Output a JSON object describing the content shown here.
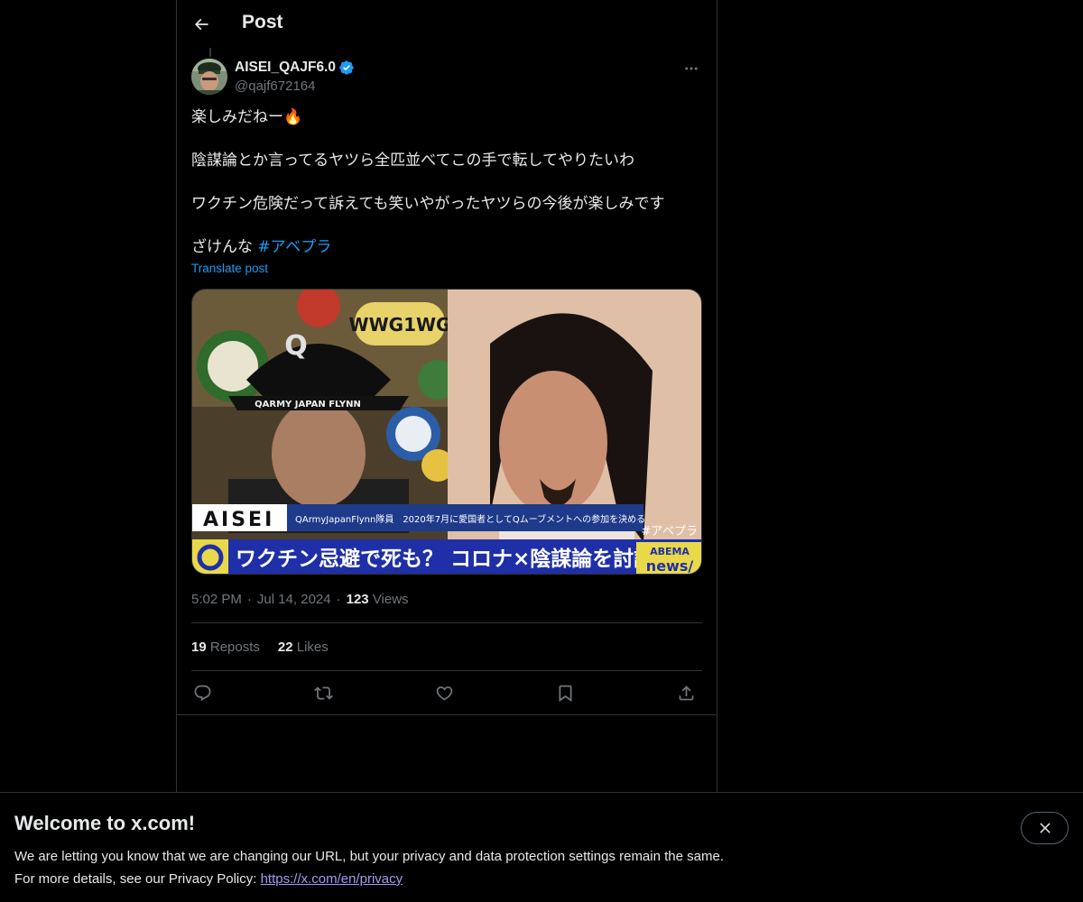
{
  "header": {
    "title": "Post"
  },
  "author": {
    "display_name": "AISEI_QAJF6.0",
    "handle": "@qajf672164",
    "verified": true
  },
  "post": {
    "lines": [
      "楽しみだねー🔥",
      "陰謀論とか言ってるヤツら全匹並べてこの手で転してやりたいわ",
      "ワクチン危険だって訴えても笑いやがったヤツらの今後が楽しみです"
    ],
    "last_line_text": "ざけんな ",
    "hashtag": "#アベプラ",
    "translate_label": "Translate post"
  },
  "media": {
    "name_plate": "AISEI",
    "caption_small": "QArmyJapanFlynn隊員　2020年7月に愛国者としてQムーブメントへの参加を決める",
    "caption_main": "ワクチン忌避で死も？ コロナ×陰謀論を討論",
    "hashtag_overlay": "#アベプラ",
    "brand_top": "ABEMA",
    "brand_bottom": "news/",
    "cap_letter": "Q",
    "cap_band": "QARMY JAPAN FLYNN",
    "sticker_text": "WWG1WG"
  },
  "meta": {
    "time": "5:02 PM",
    "date": "Jul 14, 2024",
    "views_count": "123",
    "views_label": "Views"
  },
  "stats": {
    "reposts_count": "19",
    "reposts_label": "Reposts",
    "likes_count": "22",
    "likes_label": "Likes"
  },
  "actions": [
    "reply",
    "repost",
    "like",
    "bookmark",
    "share"
  ],
  "banner": {
    "title": "Welcome to x.com!",
    "line1": "We are letting you know that we are changing our URL, but your privacy and data protection settings remain the same.",
    "line2_prefix": "For more details, see our Privacy Policy: ",
    "link": "https://x.com/en/privacy"
  },
  "colors": {
    "background": "#000000",
    "text": "#e7e9ea",
    "muted": "#71767b",
    "accent": "#1d9bf0",
    "border": "#2f3336",
    "link_visited": "#a09cf4"
  }
}
